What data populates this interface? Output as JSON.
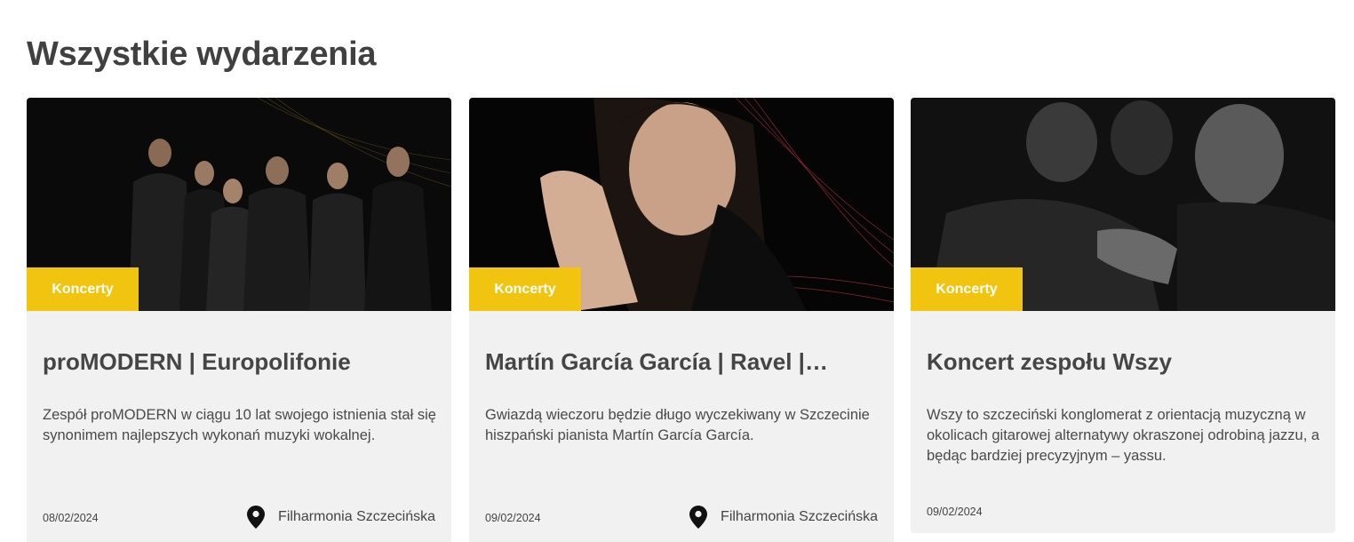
{
  "page": {
    "title": "Wszystkie wydarzenia"
  },
  "colors": {
    "badge": "#f1c40f",
    "card_bg": "#f1f1f1",
    "title_text": "#454545"
  },
  "events": [
    {
      "category": "Koncerty",
      "title": "proMODERN | Europolifonie",
      "description": "Zespół proMODERN w ciągu 10 lat swojego istnienia stał się synonimem najlepszych wykonań muzyki wokalnej.",
      "date": "08/02/2024",
      "location": "Filharmonia Szczecińska",
      "location_icon": "map-pin-icon"
    },
    {
      "category": "Koncerty",
      "title": "Martín García García | Ravel |…",
      "description": "Gwiazdą wieczoru będzie długo wyczekiwany w Szczecinie hiszpański pianista Martín García García.",
      "date": "09/02/2024",
      "location": "Filharmonia Szczecińska",
      "location_icon": "map-pin-icon"
    },
    {
      "category": "Koncerty",
      "title": "Koncert zespołu Wszy",
      "description": "Wszy to szczeciński konglomerat z orientacją muzyczną w okolicach gitarowej alternatywy okraszonej odrobiną jazzu, a będąc bardziej precyzyjnym – yassu.",
      "date": "09/02/2024"
    }
  ]
}
